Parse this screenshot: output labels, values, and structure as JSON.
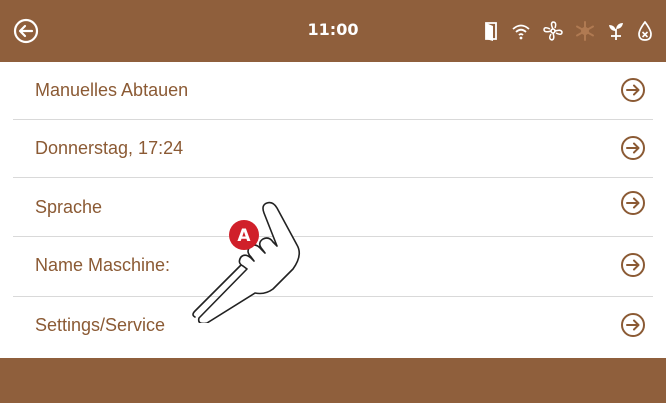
{
  "header": {
    "time": "11:00",
    "status_icons": [
      "door-icon",
      "wifi-icon",
      "fan-icon",
      "defrost-icon",
      "plant-icon",
      "water-drop-icon"
    ]
  },
  "menu": {
    "items": [
      {
        "label": "Manuelles Abtauen"
      },
      {
        "label": "Donnerstag, 17:24"
      },
      {
        "label": "Sprache"
      },
      {
        "label": "Name Maschine:"
      },
      {
        "label": "Settings/Service"
      }
    ]
  },
  "annotation": {
    "marker": "A"
  },
  "colors": {
    "accent": "#8f5f3c",
    "label": "#8b5a34",
    "marker": "#d0202a"
  }
}
